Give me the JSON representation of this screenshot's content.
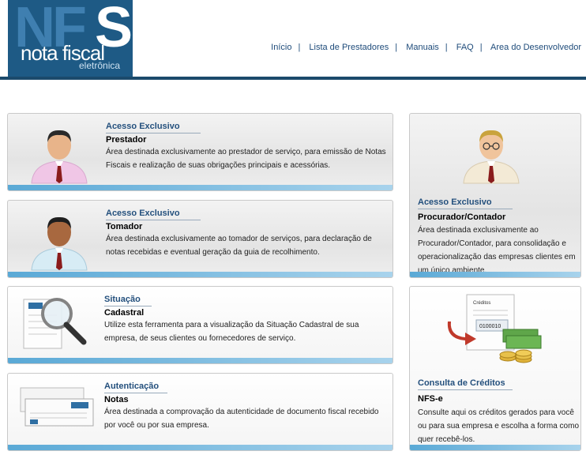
{
  "logo": {
    "nf": "NF",
    "s": "S",
    "nota": "nota fiscal",
    "eletronica": "eletrônica"
  },
  "nav": {
    "items": [
      "Início",
      "Lista de Prestadores",
      "Manuais",
      "FAQ",
      "Area do Desenvolvedor"
    ],
    "separator": "|"
  },
  "cards": {
    "prestador": {
      "kicker": "Acesso Exclusivo",
      "title": "Prestador",
      "desc": "Área destinada exclusivamente ao prestador de serviço, para emissão de Notas Fiscais e realização de suas obrigações principais e acessórias."
    },
    "tomador": {
      "kicker": "Acesso Exclusivo",
      "title": "Tomador",
      "desc": "Área destinada exclusivamente ao tomador de serviços, para declaração de notas recebidas e eventual geração da guia de recolhimento."
    },
    "situacao": {
      "kicker": "Situação",
      "title": "Cadastral",
      "desc": "Utilize esta ferramenta para a visualização da Situação Cadastral de sua empresa, de seus clientes ou fornecedores de serviço."
    },
    "autenticacao": {
      "kicker": "Autenticação",
      "title": "Notas",
      "desc": "Área destinada a comprovação da autenticidade de documento fiscal recebido por você ou por sua empresa."
    },
    "procurador": {
      "kicker": "Acesso Exclusivo",
      "title": "Procurador/Contador",
      "desc": "Área destinada exclusivamente ao Procurador/Contador, para consolidação e operacionalização das empresas clientes em um único ambiente."
    },
    "creditos": {
      "kicker": "Consulta de Créditos",
      "title": "NFS-e",
      "desc": "Consulte aqui os créditos gerados para você ou para sua empresa e escolha a forma como quer recebê-los."
    }
  },
  "doc_text": {
    "creditos": "Créditos",
    "number": "0100010"
  },
  "colors": {
    "header_bar": "#1b4a6b",
    "logo_bg": "#1e5a85",
    "link": "#1e4b7a",
    "stripe": "#5aa9d6"
  }
}
